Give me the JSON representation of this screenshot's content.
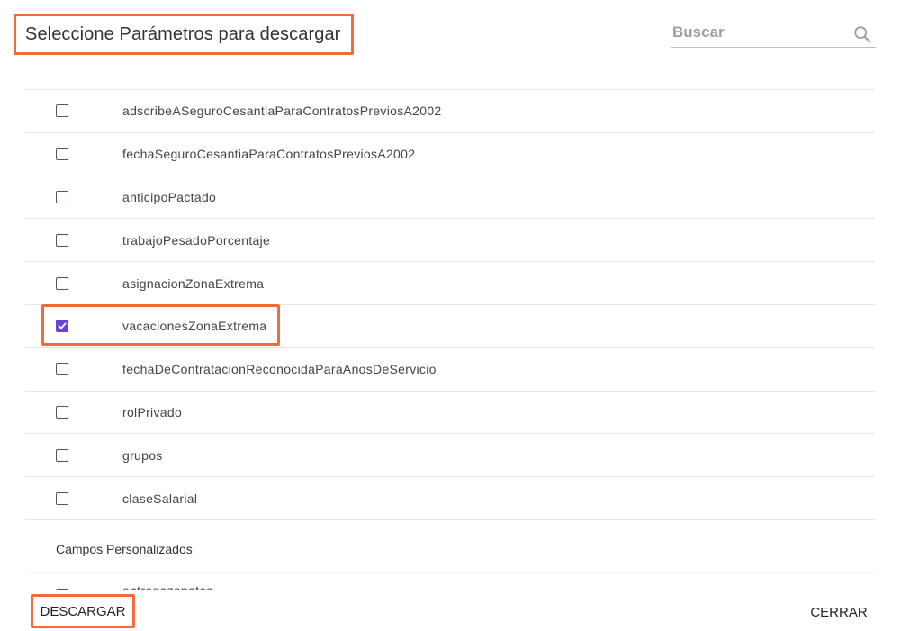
{
  "dialog": {
    "title": "Seleccione Parámetros para descargar"
  },
  "search": {
    "placeholder": "Buscar",
    "icon": "search-icon"
  },
  "params": [
    {
      "label": "adscribeASeguroCesantiaParaContratosPreviosA2002",
      "checked": false
    },
    {
      "label": "fechaSeguroCesantiaParaContratosPreviosA2002",
      "checked": false
    },
    {
      "label": "anticipoPactado",
      "checked": false
    },
    {
      "label": "trabajoPesadoPorcentaje",
      "checked": false
    },
    {
      "label": "asignacionZonaExtrema",
      "checked": false
    },
    {
      "label": "vacacionesZonaExtrema",
      "checked": true
    },
    {
      "label": "fechaDeContratacionReconocidaParaAnosDeServicio",
      "checked": false
    },
    {
      "label": "rolPrivado",
      "checked": false
    },
    {
      "label": "grupos",
      "checked": false
    },
    {
      "label": "claseSalarial",
      "checked": false
    }
  ],
  "custom_section": {
    "title": "Campos Personalizados",
    "partial_item": "entregazapatos"
  },
  "buttons": {
    "download": "DESCARGAR",
    "close": "CERRAR"
  },
  "colors": {
    "highlight": "#f26b3a",
    "checkbox_checked": "#6a44d8"
  }
}
